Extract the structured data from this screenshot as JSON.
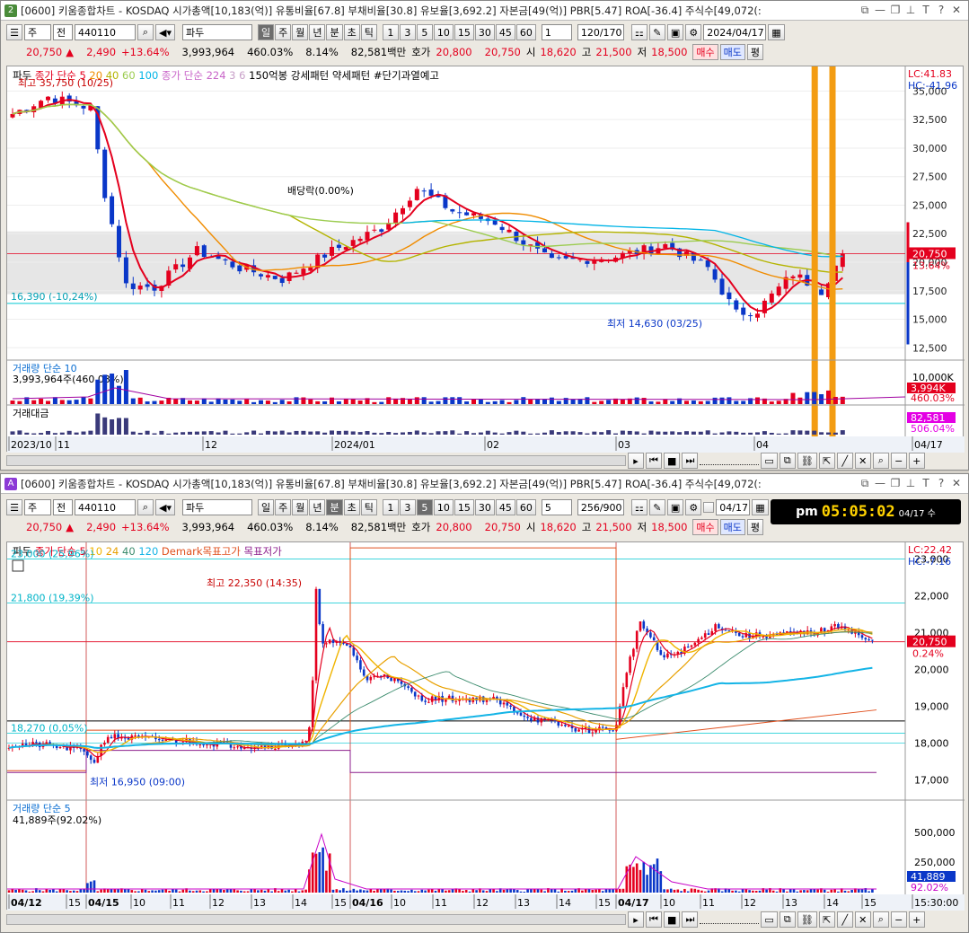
{
  "colors": {
    "up": "#e4001e",
    "down": "#0a37c8",
    "ma5": "#e4001e",
    "ma20": "#f08c00",
    "ma60": "#c8c800",
    "ma100": "#00b4e6",
    "band": "#e6e6e6",
    "titleA": "#4a8c3a",
    "titleB": "#8c3ad6"
  },
  "top": {
    "winno": "2",
    "title": "[0600] 키움종합차트 - KOSDAQ 시가총액[10,183(억)] 유통비율[67.8] 부채비율[30.8] 유보율[3,692.2] 자본금[49(억)] PBR[5.47] ROA[-36.4] 주식수[49,072(:",
    "toolbar": {
      "kind": "주",
      "range": "전",
      "code": "440110",
      "name": "파두",
      "periods": [
        "일",
        "주",
        "월",
        "년",
        "분",
        "초",
        "틱"
      ],
      "nums": [
        "1",
        "3",
        "5",
        "10",
        "15",
        "30",
        "45",
        "60"
      ],
      "sel": "1",
      "count": "120/170",
      "date": "2024/04/17"
    },
    "quote": {
      "price": "20,750",
      "arrow": "▲",
      "change": "2,490",
      "rate": "+13.64%",
      "volume": "3,993,964",
      "vrate": "460.03%",
      "turn": "8.14%",
      "amount": "82,581백만",
      "hoga_l": "호가",
      "hoga": "20,800",
      "hoga2": "20,750",
      "open_l": "시",
      "open": "18,620",
      "high_l": "고",
      "high": "21,500",
      "low_l": "저",
      "low": "18,500",
      "buy": "매수",
      "sell": "매도",
      "flat": "평"
    },
    "legend": {
      "name": "파두",
      "ma": "종가 단순 5",
      "ma_vals": [
        "20",
        "40",
        "60",
        "100"
      ],
      "ma2": "종가 단순 224",
      "ma2_vals": [
        "3",
        "6"
      ],
      "pattern1": "150억봉 강세패턴",
      "pattern2": "약세패턴",
      "alert": "#단기과열예고"
    },
    "ann": {
      "high": "최고 35,750 (10/25)",
      "low": "최저 14,630 (03/25)",
      "dividend": "배당락(0.00%)",
      "support": "16,390 (-10,24%)",
      "lc": "LC:41.83",
      "hc": "HC:-41.96",
      "pricetag": "20,750",
      "ratetag": "13.64%"
    },
    "yticks": [
      "35,000",
      "32,500",
      "30,000",
      "27,500",
      "25,000",
      "22,500",
      "20,000",
      "17,500",
      "15,000",
      "12,500"
    ],
    "vol": {
      "title": "거래량 단순 10",
      "value": "3,993,964주(460.03%)",
      "tick": "10,000K",
      "tag1": "3,994K",
      "tag2": "460.03%"
    },
    "amt": {
      "title": "거래대금",
      "tag1": "82,581",
      "tag2": "506.04%"
    },
    "xticks": [
      "2023/10",
      "11",
      "12",
      "2024/01",
      "02",
      "03",
      "04",
      "04/17"
    ]
  },
  "bottom": {
    "winno": "A",
    "title": "[0600] 키움종합차트 - KOSDAQ 시가총액[10,183(억)] 유통비율[67.8] 부채비율[30.8] 유보율[3,692.2] 자본금[49(억)] PBR[5.47] ROA[-36.4] 주식수[49,072(:",
    "toolbar": {
      "kind": "주",
      "range": "전",
      "code": "440110",
      "name": "파두",
      "periods": [
        "일",
        "주",
        "월",
        "년",
        "분",
        "초",
        "틱"
      ],
      "nums": [
        "1",
        "3",
        "5",
        "10",
        "15",
        "30",
        "45",
        "60"
      ],
      "sel": "5",
      "count": "256/900",
      "date": "04/17"
    },
    "clock": {
      "ampm": "pm",
      "time": "05:05:02",
      "date": "04/17 수"
    },
    "quote": {
      "price": "20,750",
      "arrow": "▲",
      "change": "2,490",
      "rate": "+13.64%",
      "volume": "3,993,964",
      "vrate": "460.03%",
      "turn": "8.14%",
      "amount": "82,581백만",
      "hoga_l": "호가",
      "hoga": "20,800",
      "hoga2": "20,750",
      "open_l": "시",
      "open": "18,620",
      "high_l": "고",
      "high": "21,500",
      "low_l": "저",
      "low": "18,500",
      "buy": "매수",
      "sell": "매도",
      "flat": "평"
    },
    "legend": {
      "name": "파두",
      "ma": "종가 단순 5",
      "ma_vals": [
        "10",
        "24",
        "40",
        "120"
      ],
      "demark": "Demark목표고가",
      "demark2": "목표저가"
    },
    "ann": {
      "high": "최고 22,350 (14:35)",
      "low": "최저 16,950 (09:00)",
      "l23": "23,000 (25,96%)",
      "l218": "21,800 (19,39%)",
      "l1827": "18,270 (0,05%)",
      "lc": "LC:22.42",
      "hc": "HC:-7.16",
      "pricetag": "20,750",
      "ratetag": "0.24%"
    },
    "yticks": [
      "23,000",
      "22,000",
      "21,000",
      "20,000",
      "19,000",
      "18,000",
      "17,000"
    ],
    "vol": {
      "title": "거래량 단순 5",
      "value": "41,889주(92.02%)",
      "t1": "500,000",
      "t2": "250,000",
      "tag1": "41,889",
      "tag2": "92.02%"
    },
    "xticks": [
      "04/12",
      "15",
      "04/15",
      "10",
      "11",
      "12",
      "13",
      "14",
      "15",
      "04/16",
      "10",
      "11",
      "12",
      "13",
      "14",
      "15",
      "04/17",
      "10",
      "11",
      "12",
      "13",
      "14",
      "15",
      "15:30:00"
    ]
  }
}
